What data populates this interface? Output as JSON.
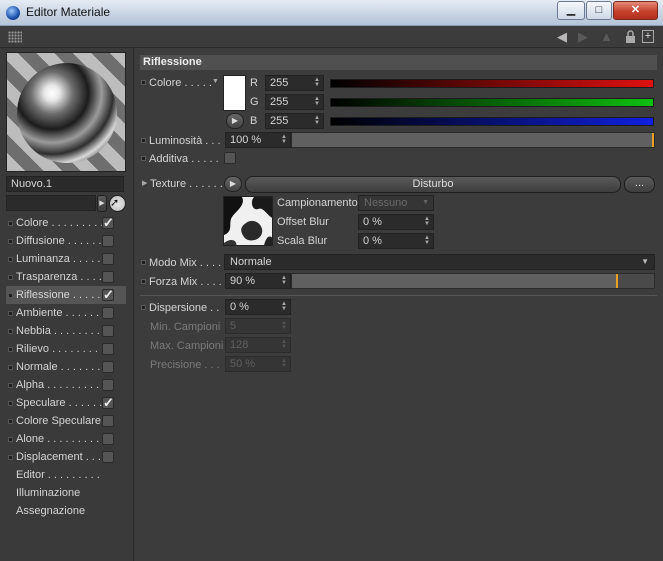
{
  "window": {
    "title": "Editor Materiale",
    "minimize": "▁",
    "maximize": "□",
    "close": "✕"
  },
  "toolbar": {
    "back": "◀",
    "forward": "▶",
    "up": "▲"
  },
  "material_name": "Nuovo.1",
  "channels": [
    {
      "label": "Colore . . . . . . . . .",
      "checked": true
    },
    {
      "label": "Diffusione . . . . . . .",
      "checked": false
    },
    {
      "label": "Luminanza . . . . . . .",
      "checked": false
    },
    {
      "label": "Trasparenza . . . . .",
      "checked": false
    },
    {
      "label": "Riflessione . . . . . .",
      "checked": true,
      "selected": true
    },
    {
      "label": "Ambiente . . . . . . .",
      "checked": false
    },
    {
      "label": "Nebbia . . . . . . . . .",
      "checked": false
    },
    {
      "label": "Rilievo . . . . . . . . .",
      "checked": false
    },
    {
      "label": "Normale . . . . . . . .",
      "checked": false
    },
    {
      "label": "Alpha . . . . . . . . . .",
      "checked": false
    },
    {
      "label": "Speculare . . . . . . .",
      "checked": true
    },
    {
      "label": "Colore Speculare",
      "checked": false
    },
    {
      "label": "Alone . . . . . . . . . .",
      "checked": false
    },
    {
      "label": "Displacement . . . .",
      "checked": false
    }
  ],
  "extra_items": [
    "Editor . . . . . . . . .",
    "Illuminazione",
    "Assegnazione"
  ],
  "section_title": "Riflessione",
  "color": {
    "label": "Colore . . . . .",
    "r_label": "R",
    "r_value": "255",
    "g_label": "G",
    "g_value": "255",
    "b_label": "B",
    "b_value": "255"
  },
  "luminosita": {
    "label": "Luminosità . . .",
    "value": "100 %",
    "level": 1.0
  },
  "additiva": {
    "label": "Additiva . . . . ."
  },
  "texture": {
    "label": "Texture . . . . . .",
    "shader": "Disturbo",
    "more": "...",
    "campionamento_label": "Campionamento",
    "campionamento_value": "Nessuno",
    "offset_blur_label": "Offset Blur",
    "offset_blur_value": "0 %",
    "scala_blur_label": "Scala Blur",
    "scala_blur_value": "0 %"
  },
  "modo_mix": {
    "label": "Modo Mix . . . .",
    "value": "Normale"
  },
  "forza_mix": {
    "label": "Forza Mix . . . .",
    "value": "90 %",
    "level": 0.9
  },
  "dispersione": {
    "label": "Dispersione . .",
    "value": "0 %"
  },
  "min_campioni": {
    "label": "Min. Campioni",
    "value": "5"
  },
  "max_campioni": {
    "label": "Max. Campioni",
    "value": "128"
  },
  "precisione": {
    "label": "Precisione . . .",
    "value": "50 %"
  },
  "colors": {
    "red": "#e01010",
    "green": "#10c010",
    "blue": "#1020e0",
    "accent": "#e8a020"
  }
}
